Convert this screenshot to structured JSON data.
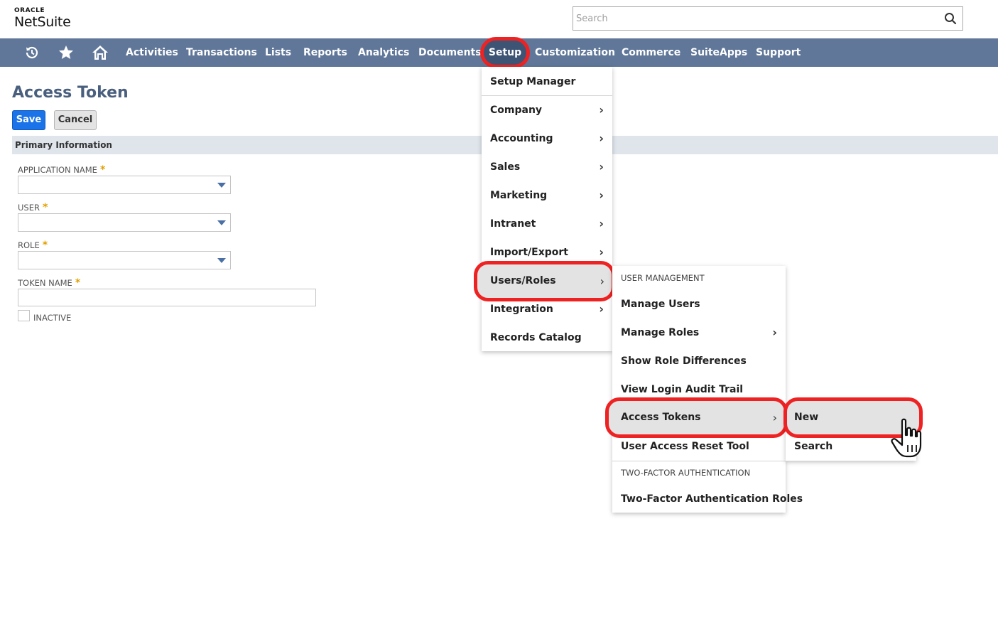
{
  "header": {
    "logo_top": "ORACLE",
    "logo_bottom": "NetSuite",
    "search_placeholder": "Search"
  },
  "nav": {
    "items": [
      "Activities",
      "Transactions",
      "Lists",
      "Reports",
      "Analytics",
      "Documents",
      "Setup",
      "Customization",
      "Commerce",
      "SuiteApps",
      "Support"
    ],
    "icons": [
      "recent-icon",
      "star-icon",
      "home-icon"
    ]
  },
  "page": {
    "title": "Access Token",
    "save_label": "Save",
    "cancel_label": "Cancel",
    "section": "Primary Information",
    "fields": {
      "application": "APPLICATION NAME",
      "user": "USER",
      "role": "ROLE",
      "token_name": "TOKEN NAME",
      "inactive": "INACTIVE"
    },
    "required_mark": "*"
  },
  "setup_menu": {
    "items": [
      "Setup Manager",
      "Company",
      "Accounting",
      "Sales",
      "Marketing",
      "Intranet",
      "Import/Export",
      "Users/Roles",
      "Integration",
      "Records Catalog"
    ]
  },
  "users_roles_menu": {
    "heading1": "USER MANAGEMENT",
    "items1": [
      "Manage Users",
      "Manage Roles",
      "Show Role Differences",
      "View Login Audit Trail",
      "Access Tokens",
      "User Access Reset Tool"
    ],
    "heading2": "TWO-FACTOR AUTHENTICATION",
    "items2": [
      "Two-Factor Authentication Roles"
    ]
  },
  "access_tokens_menu": {
    "items": [
      "New",
      "Search"
    ]
  },
  "colors": {
    "nav": "#607799",
    "highlight": "#ee2222",
    "title": "#4a5f7e",
    "save": "#1a73e8"
  }
}
